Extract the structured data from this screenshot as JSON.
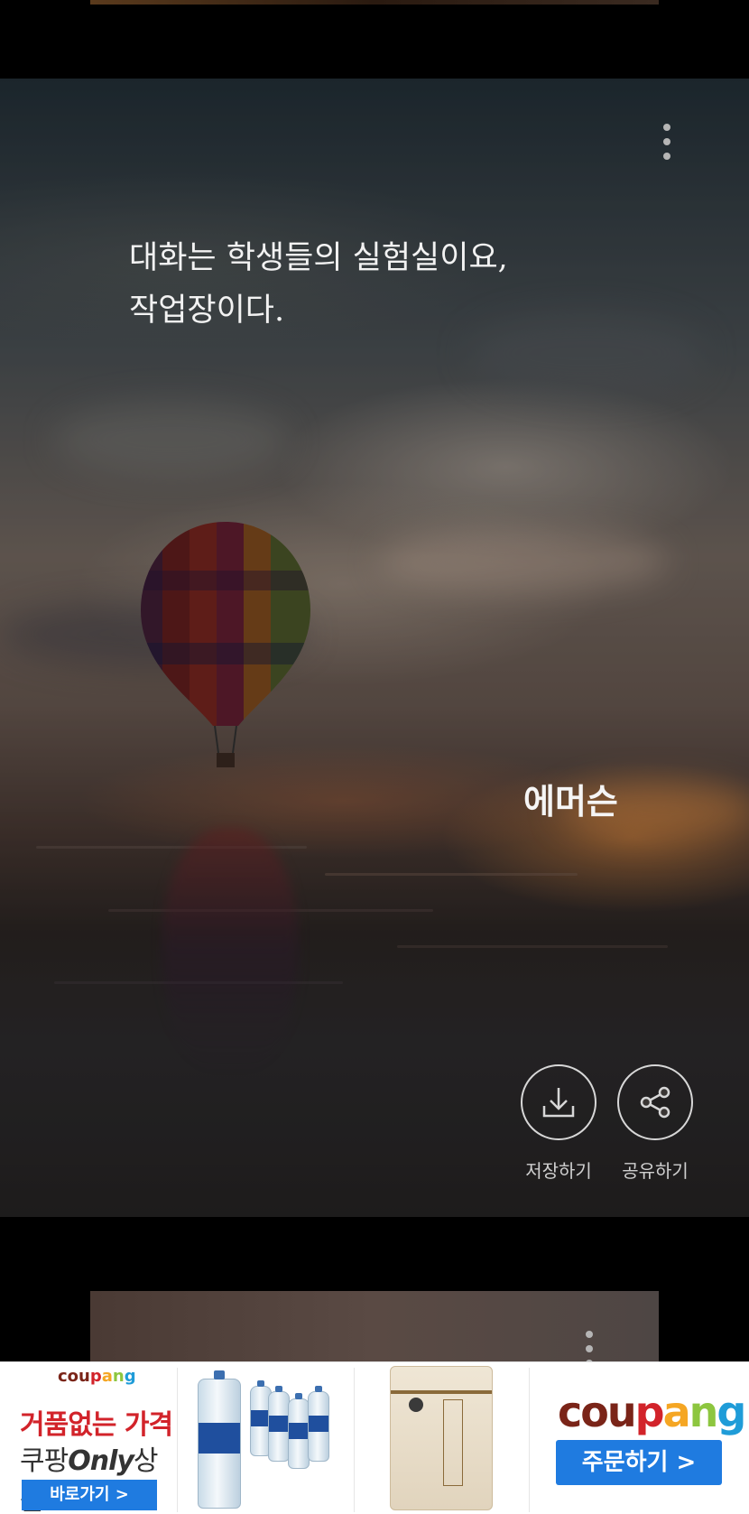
{
  "quote_card": {
    "quote_text": "대화는 학생들의 실험실이요,\n 작업장이다.",
    "author": "에머슨",
    "menu_icon": "more-vertical-icon",
    "actions": [
      {
        "label": "저장하기",
        "icon": "download-icon"
      },
      {
        "label": "공유하기",
        "icon": "share-icon"
      }
    ]
  },
  "ad_banner": {
    "brand_small": "coupang",
    "headline": "거품없는 가격",
    "subline_prefix": "쿠팡",
    "subline_em": "Only",
    "subline_suffix": "상품",
    "goto_label": "바로가기 >",
    "brand_large": "coupang",
    "order_label": "주문하기 >",
    "brand_colors": [
      "#7a2418",
      "#d2232a",
      "#f5a623",
      "#8dc63f",
      "#1f9cd8"
    ]
  }
}
